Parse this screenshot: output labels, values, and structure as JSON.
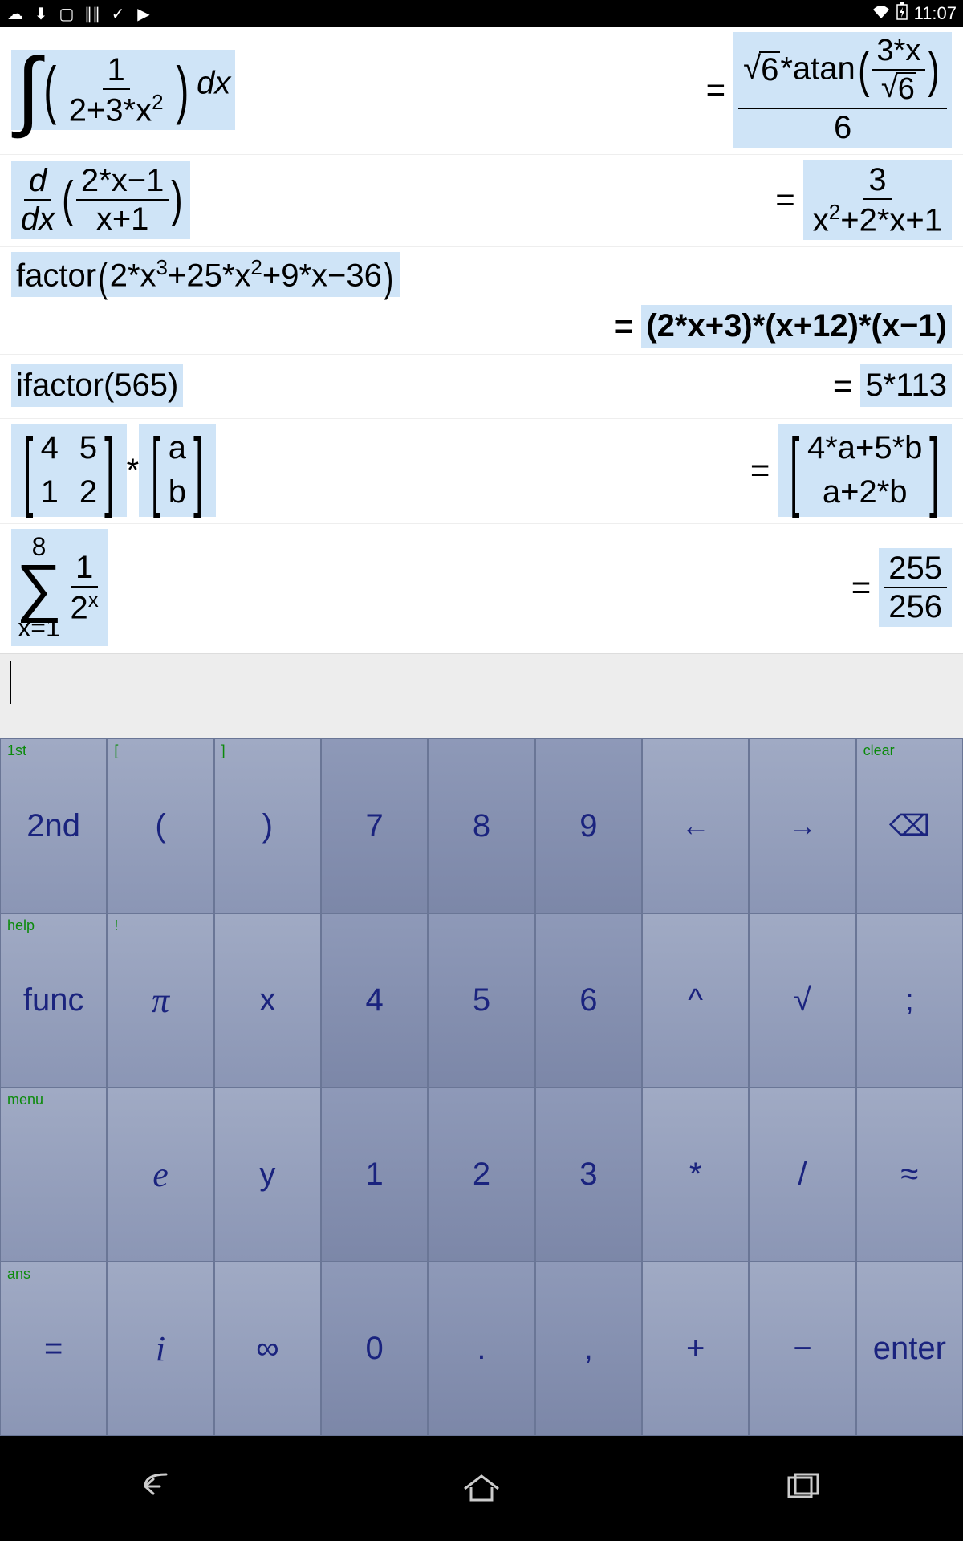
{
  "status": {
    "time": "11:07",
    "icons_left": [
      "cloud-up",
      "download",
      "image",
      "bars",
      "clipboard-check",
      "play-store"
    ],
    "icons_right": [
      "wifi",
      "battery-charging"
    ]
  },
  "history": [
    {
      "lhs_type": "integral",
      "lhs_frac_num": "1",
      "lhs_frac_den_a": "2+3*x",
      "lhs_frac_den_exp": "2",
      "lhs_dx": "dx",
      "rhs_num_sqrt": "6",
      "rhs_num_fn": "*atan",
      "rhs_num_arg_num": "3*x",
      "rhs_num_arg_den_sqrt": "6",
      "rhs_den": "6"
    },
    {
      "lhs_type": "derivative",
      "lhs_d": "d",
      "lhs_dx": "dx",
      "lhs_arg_num": "2*x−1",
      "lhs_arg_den": "x+1",
      "rhs_num": "3",
      "rhs_den_a": "x",
      "rhs_den_exp": "2",
      "rhs_den_b": "+2*x+1"
    },
    {
      "lhs_type": "factor",
      "lhs_fn": "factor",
      "lhs_arg_a": "2*x",
      "lhs_arg_e1": "3",
      "lhs_arg_b": "+25*x",
      "lhs_arg_e2": "2",
      "lhs_arg_c": "+9*x−36",
      "rhs": "(2*x+3)*(x+12)*(x−1)"
    },
    {
      "lhs_type": "ifactor",
      "lhs_fn": "ifactor",
      "lhs_arg": "565",
      "rhs": "5*113"
    },
    {
      "lhs_type": "matrix",
      "m1": [
        [
          "4",
          "5"
        ],
        [
          "1",
          "2"
        ]
      ],
      "op": "*",
      "m2": [
        [
          "a"
        ],
        [
          "b"
        ]
      ],
      "rhs": [
        [
          "4*a+5*b"
        ],
        [
          "a+2*b"
        ]
      ]
    },
    {
      "lhs_type": "sum",
      "upper": "8",
      "lower": "x=1",
      "term_num": "1",
      "term_den_base": "2",
      "term_den_exp": "x",
      "rhs_num": "255",
      "rhs_den": "256"
    }
  ],
  "keyboard": {
    "rows": [
      [
        {
          "main": "2nd",
          "alt": "1st",
          "dark": false,
          "name": "second"
        },
        {
          "main": "(",
          "alt": "[",
          "dark": false,
          "name": "lparen"
        },
        {
          "main": ")",
          "alt": "]",
          "dark": false,
          "name": "rparen"
        },
        {
          "main": "7",
          "alt": "",
          "dark": true,
          "name": "seven"
        },
        {
          "main": "8",
          "alt": "",
          "dark": true,
          "name": "eight"
        },
        {
          "main": "9",
          "alt": "",
          "dark": true,
          "name": "nine"
        },
        {
          "main": "←",
          "alt": "",
          "dark": false,
          "name": "cursor-left",
          "arrow": true
        },
        {
          "main": "→",
          "alt": "",
          "dark": false,
          "name": "cursor-right",
          "arrow": true
        },
        {
          "main": "⌫",
          "alt": "clear",
          "dark": false,
          "name": "backspace",
          "arrow": true
        }
      ],
      [
        {
          "main": "func",
          "alt": "help",
          "dark": false,
          "name": "func"
        },
        {
          "main": "π",
          "alt": "!",
          "dark": false,
          "name": "pi",
          "ital": true
        },
        {
          "main": "x",
          "alt": "",
          "dark": false,
          "name": "var-x"
        },
        {
          "main": "4",
          "alt": "",
          "dark": true,
          "name": "four"
        },
        {
          "main": "5",
          "alt": "",
          "dark": true,
          "name": "five"
        },
        {
          "main": "6",
          "alt": "",
          "dark": true,
          "name": "six"
        },
        {
          "main": "^",
          "alt": "",
          "dark": false,
          "name": "power"
        },
        {
          "main": "√",
          "alt": "",
          "dark": false,
          "name": "sqrt"
        },
        {
          "main": ";",
          "alt": "",
          "dark": false,
          "name": "semicolon"
        }
      ],
      [
        {
          "main": "⌨",
          "alt": "menu",
          "dark": false,
          "name": "keyboard-toggle",
          "icon": true
        },
        {
          "main": "e",
          "alt": "",
          "dark": false,
          "name": "euler",
          "ital": true
        },
        {
          "main": "y",
          "alt": "",
          "dark": false,
          "name": "var-y"
        },
        {
          "main": "1",
          "alt": "",
          "dark": true,
          "name": "one"
        },
        {
          "main": "2",
          "alt": "",
          "dark": true,
          "name": "two"
        },
        {
          "main": "3",
          "alt": "",
          "dark": true,
          "name": "three"
        },
        {
          "main": "*",
          "alt": "",
          "dark": false,
          "name": "multiply"
        },
        {
          "main": "/",
          "alt": "",
          "dark": false,
          "name": "divide"
        },
        {
          "main": "≈",
          "alt": "",
          "dark": false,
          "name": "approx"
        }
      ],
      [
        {
          "main": "=",
          "alt": "ans",
          "dark": false,
          "name": "equals"
        },
        {
          "main": "i",
          "alt": "",
          "dark": false,
          "name": "imaginary",
          "ital": true
        },
        {
          "main": "∞",
          "alt": "",
          "dark": false,
          "name": "infinity"
        },
        {
          "main": "0",
          "alt": "",
          "dark": true,
          "name": "zero"
        },
        {
          "main": ".",
          "alt": "",
          "dark": true,
          "name": "decimal"
        },
        {
          "main": ",",
          "alt": "",
          "dark": true,
          "name": "comma"
        },
        {
          "main": "+",
          "alt": "",
          "dark": false,
          "name": "plus"
        },
        {
          "main": "−",
          "alt": "",
          "dark": false,
          "name": "minus"
        },
        {
          "main": "enter",
          "alt": "",
          "dark": false,
          "name": "enter"
        }
      ]
    ]
  },
  "nav": [
    "back",
    "home",
    "recent"
  ]
}
